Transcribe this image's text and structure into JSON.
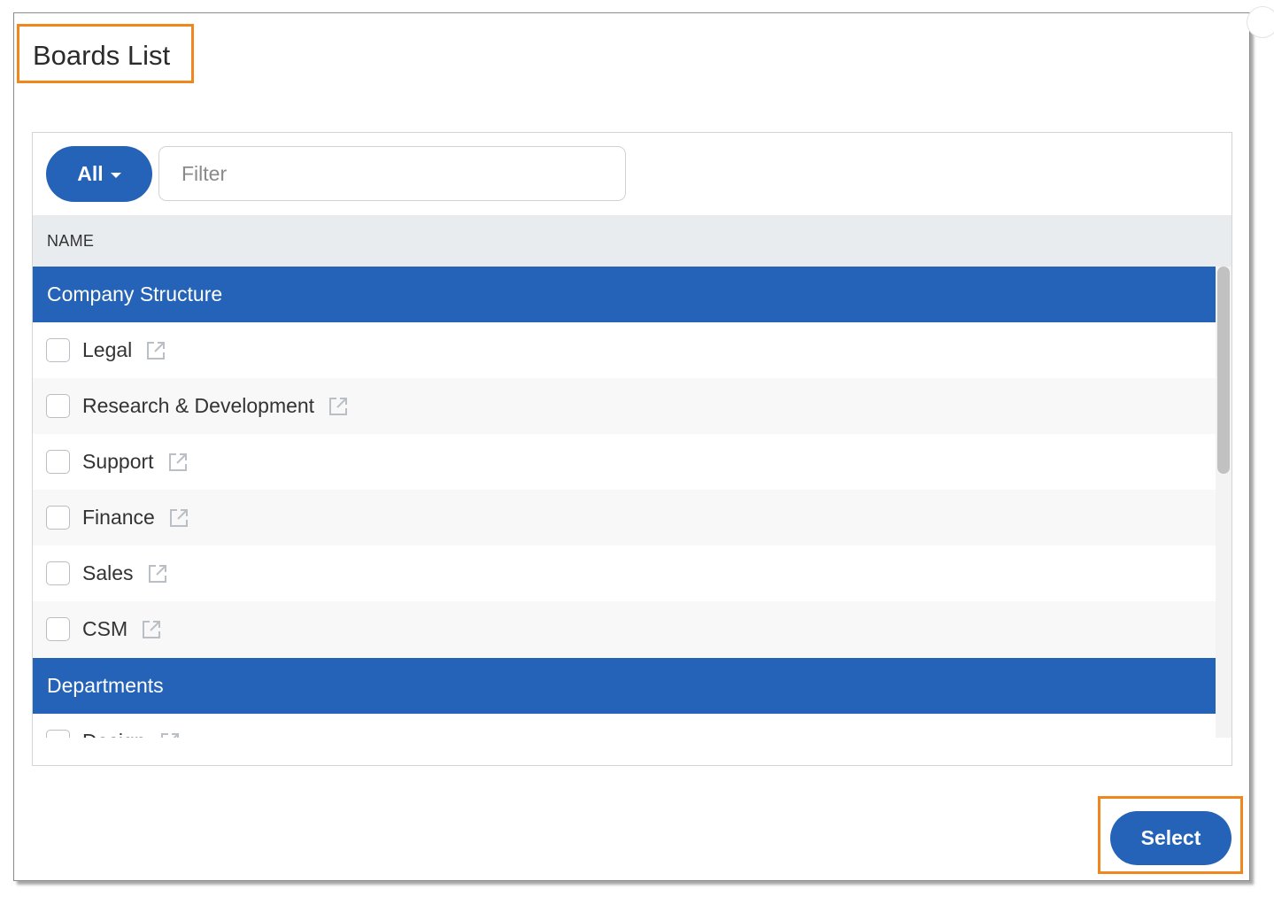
{
  "modal": {
    "title": "Boards List"
  },
  "toolbar": {
    "scope_label": "All",
    "filter_placeholder": "Filter"
  },
  "table": {
    "column_header": "NAME"
  },
  "groups": [
    {
      "label": "Company Structure",
      "items": [
        "Legal",
        "Research & Development",
        "Support",
        "Finance",
        "Sales",
        "CSM"
      ]
    },
    {
      "label": "Departments",
      "items": [
        "Design"
      ]
    }
  ],
  "footer": {
    "select_label": "Select"
  },
  "colors": {
    "accent": "#2563b8",
    "highlight": "#f0871e"
  },
  "icons": {
    "external_link": "external-link-icon",
    "dropdown": "caret-down-icon"
  }
}
